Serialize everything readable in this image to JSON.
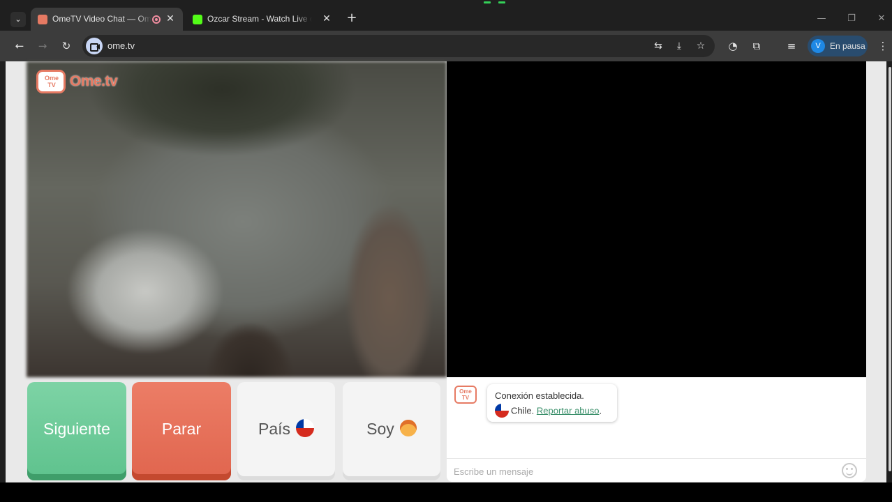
{
  "tabs": [
    {
      "title": "OmeTV Video Chat — Ome",
      "active": true,
      "favicon_color": "#e67a63"
    },
    {
      "title": "Ozcar Stream - Watch Live on K",
      "active": false,
      "favicon_color": "#53fc18"
    }
  ],
  "icons": {
    "tab_menu": "⌄",
    "close": "✕",
    "new_tab": "+",
    "minimize": "—",
    "restore": "❐",
    "window_close": "✕",
    "back": "←",
    "forward": "→",
    "reload": "↻",
    "translate": "⇆",
    "install": "⤓",
    "bookmark": "☆",
    "extension_ghost": "◔",
    "extensions": "⧉",
    "media": "≡",
    "menu": "⋮"
  },
  "address_bar": {
    "url": "ome.tv"
  },
  "profile": {
    "initial": "V",
    "label": "En pausa"
  },
  "logo": {
    "tv_text": "Ome TV",
    "wordmark": "Ome.tv"
  },
  "buttons": {
    "next": "Siguiente",
    "stop": "Parar",
    "country": "País",
    "gender": "Soy"
  },
  "chat": {
    "logo_text": "Ome TV",
    "status": "Conexión establecida.",
    "country": "Chile.",
    "report_link": "Reportar abuso",
    "report_suffix": ".",
    "input_placeholder": "Escribe un mensaje"
  },
  "colors": {
    "next": "#5ec28d",
    "stop": "#e0654e",
    "brand": "#e67a63"
  }
}
